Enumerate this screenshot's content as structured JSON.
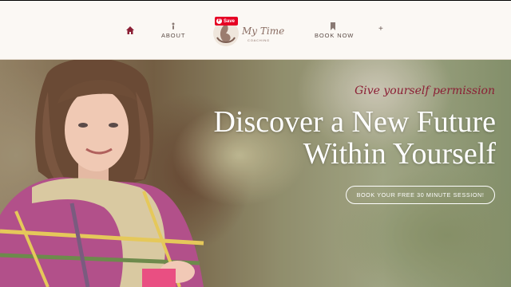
{
  "header": {
    "nav_about": "ABOUT",
    "nav_book": "BOOK NOW",
    "nav_plus": "+",
    "logo_text": "My Time",
    "logo_sub": "COACHING",
    "pin_save": "Save"
  },
  "hero": {
    "tagline": "Give yourself permission",
    "headline_line1": "Discover a New Future",
    "headline_line2": "Within Yourself",
    "cta_label": "BOOK YOUR FREE 30 MINUTE SESSION!"
  },
  "colors": {
    "accent": "#8b1f35",
    "header_bg": "#fbf8f4",
    "nav_text": "#5a4a44",
    "pinterest": "#e60023"
  },
  "icons": [
    "home-icon",
    "person-icon",
    "bookmark-icon",
    "pinterest-icon"
  ]
}
